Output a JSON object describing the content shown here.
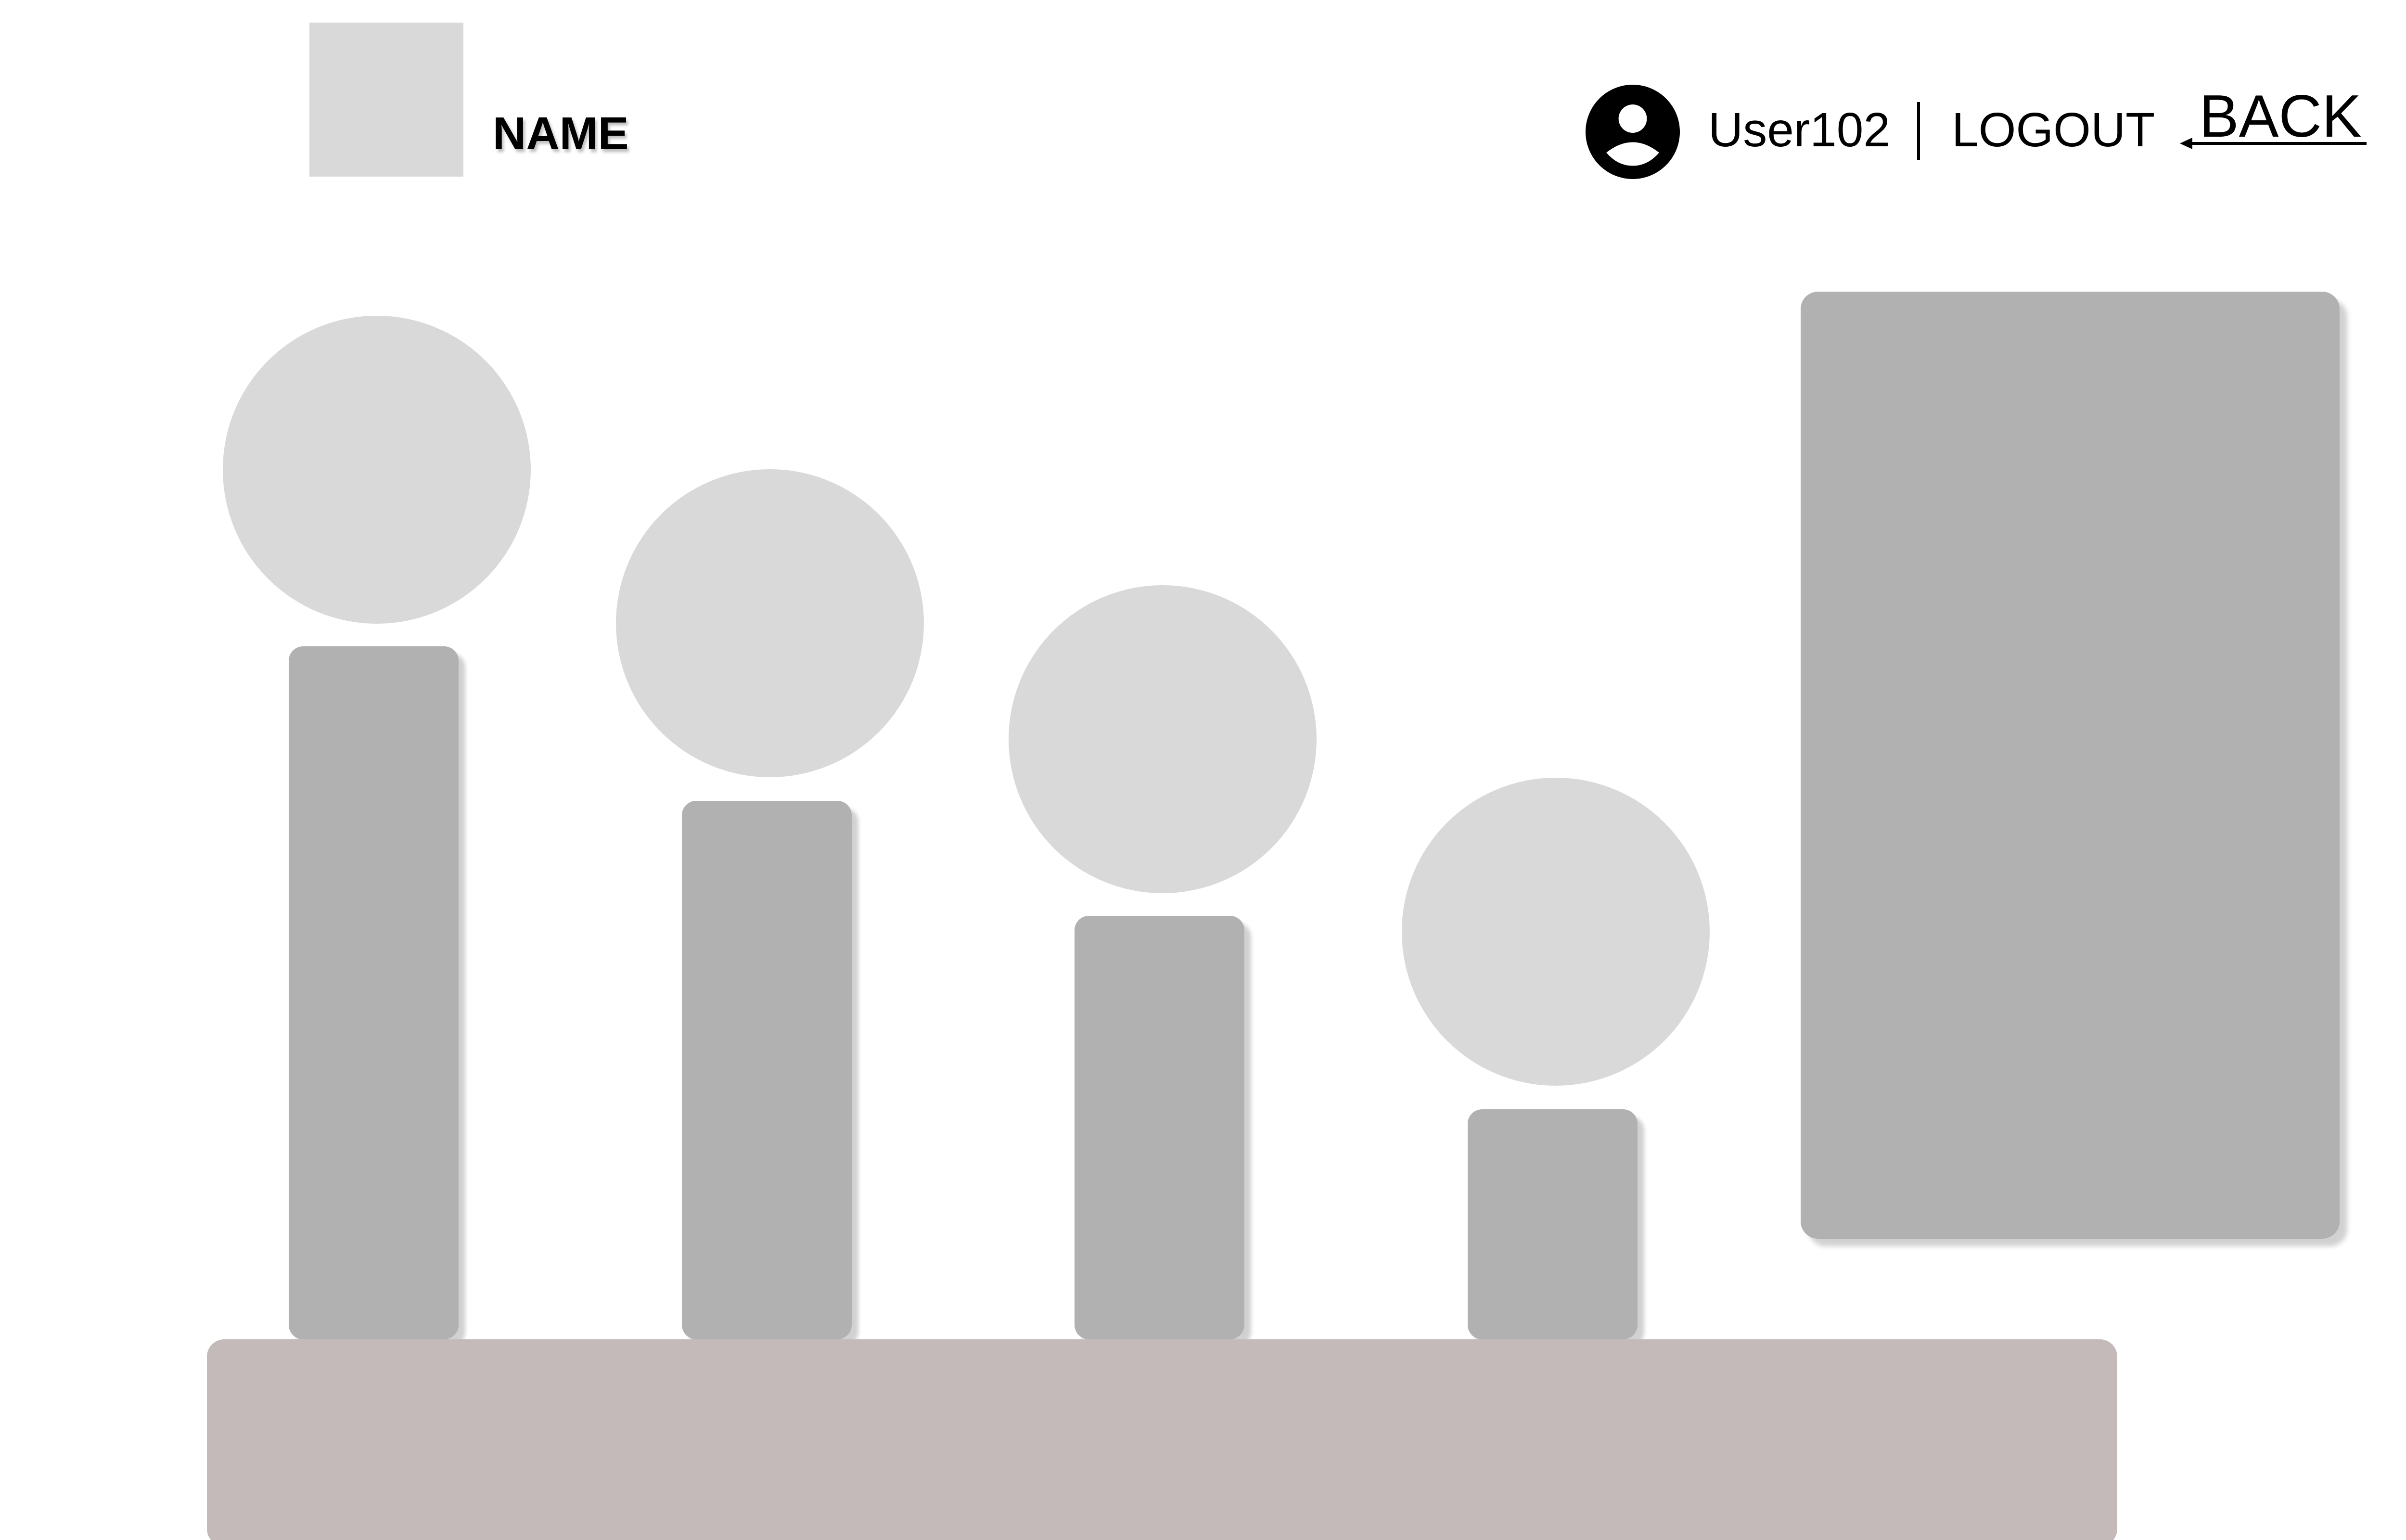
{
  "header": {
    "brand_name": "NAME",
    "username": "User102",
    "logout_label": "LOGOUT",
    "back_label": "BACK"
  },
  "icons": {
    "avatar": "user-circle-icon",
    "back": "arrow-left-icon"
  },
  "colors": {
    "placeholder_light": "#d9d9d9",
    "bar_gray": "#b1b1b1",
    "platform": "#c4baba",
    "text": "#000000"
  }
}
